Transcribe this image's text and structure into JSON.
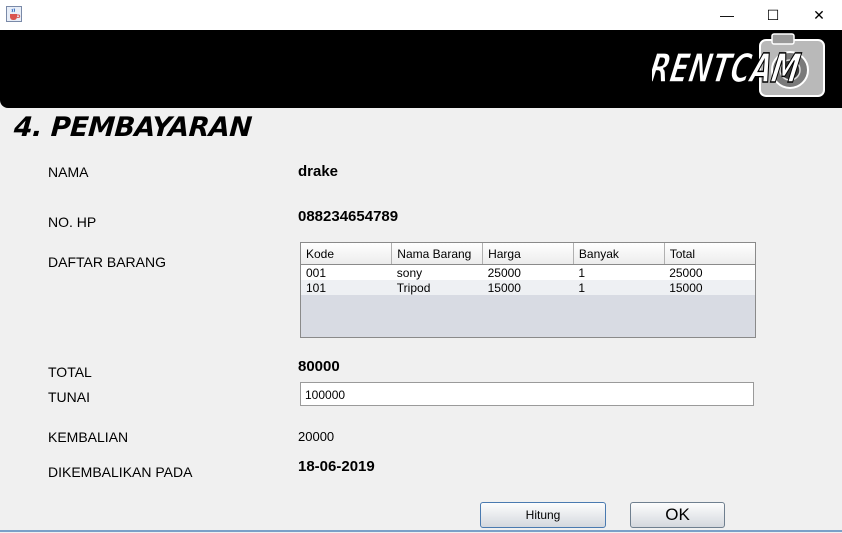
{
  "window": {
    "minimize_glyph": "—",
    "maximize_glyph": "☐",
    "close_glyph": "✕"
  },
  "banner": {
    "logo_text": "RENTCAM"
  },
  "page": {
    "heading": "4. PEMBAYARAN"
  },
  "form": {
    "nama_label": "NAMA",
    "nama_value": "drake",
    "hp_label": "NO. HP",
    "hp_value": "088234654789",
    "daftar_label": "DAFTAR BARANG",
    "total_label": "TOTAL",
    "total_value": "80000",
    "tunai_label": "TUNAI",
    "tunai_value": "100000",
    "kembalian_label": "KEMBALIAN",
    "kembalian_value": "20000",
    "dikembalikan_label": "DIKEMBALIKAN PADA",
    "dikembalikan_value": "18-06-2019"
  },
  "table": {
    "columns": [
      "Kode",
      "Nama Barang",
      "Harga",
      "Banyak",
      "Total"
    ],
    "rows": [
      [
        "001",
        "sony",
        "25000",
        "1",
        "25000"
      ],
      [
        "101",
        "Tripod",
        "15000",
        "1",
        "15000"
      ]
    ]
  },
  "buttons": {
    "hitung": "Hitung",
    "ok": "OK"
  },
  "colors": {
    "banner": "#000000",
    "background": "#f0f0f0"
  }
}
